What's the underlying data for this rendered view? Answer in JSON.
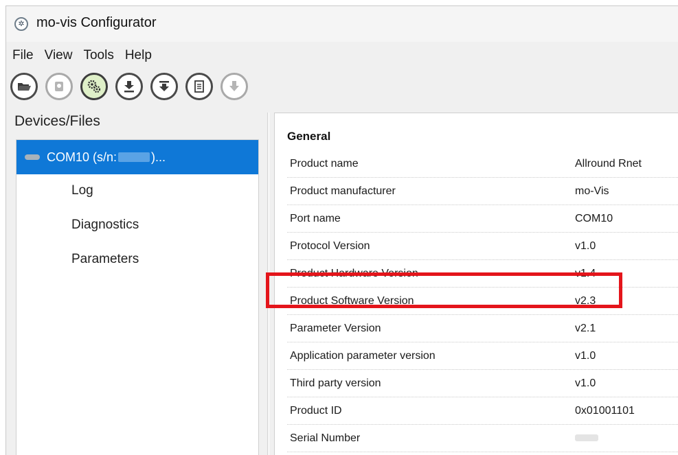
{
  "window": {
    "title": "mo-vis Configurator",
    "app_icon": "gear-icon"
  },
  "menu": {
    "items": [
      "File",
      "View",
      "Tools",
      "Help"
    ]
  },
  "toolbar": {
    "buttons": [
      {
        "icon": "open-folder-icon",
        "state": "enabled"
      },
      {
        "icon": "device-connect-icon",
        "state": "disabled"
      },
      {
        "icon": "configure-gears-icon",
        "state": "active"
      },
      {
        "icon": "download-icon",
        "state": "enabled"
      },
      {
        "icon": "download-all-icon",
        "state": "enabled"
      },
      {
        "icon": "report-icon",
        "state": "enabled"
      },
      {
        "icon": "arrow-down-icon",
        "state": "disabled"
      }
    ]
  },
  "left_panel": {
    "title": "Devices/Files",
    "root": {
      "prefix": "COM10 (s/n:",
      "suffix": ")..."
    },
    "children": [
      "Log",
      "Diagnostics",
      "Parameters"
    ]
  },
  "right_panel": {
    "section": "General",
    "rows": [
      {
        "label": "Product name",
        "value": "Allround Rnet"
      },
      {
        "label": "Product manufacturer",
        "value": "mo-Vis"
      },
      {
        "label": "Port name",
        "value": "COM10"
      },
      {
        "label": "Protocol Version",
        "value": "v1.0"
      },
      {
        "label": "Product Hardware Version",
        "value": "v1.4"
      },
      {
        "label": "Product Software Version",
        "value": "v2.3"
      },
      {
        "label": "Parameter Version",
        "value": "v2.1"
      },
      {
        "label": "Application parameter version",
        "value": "v1.0"
      },
      {
        "label": "Third party version",
        "value": "v1.0"
      },
      {
        "label": "Product ID",
        "value": "0x01001101"
      },
      {
        "label": "Serial Number",
        "value": ""
      }
    ]
  },
  "colors": {
    "selection": "#0f78d7",
    "highlight_box": "#e4151b"
  }
}
